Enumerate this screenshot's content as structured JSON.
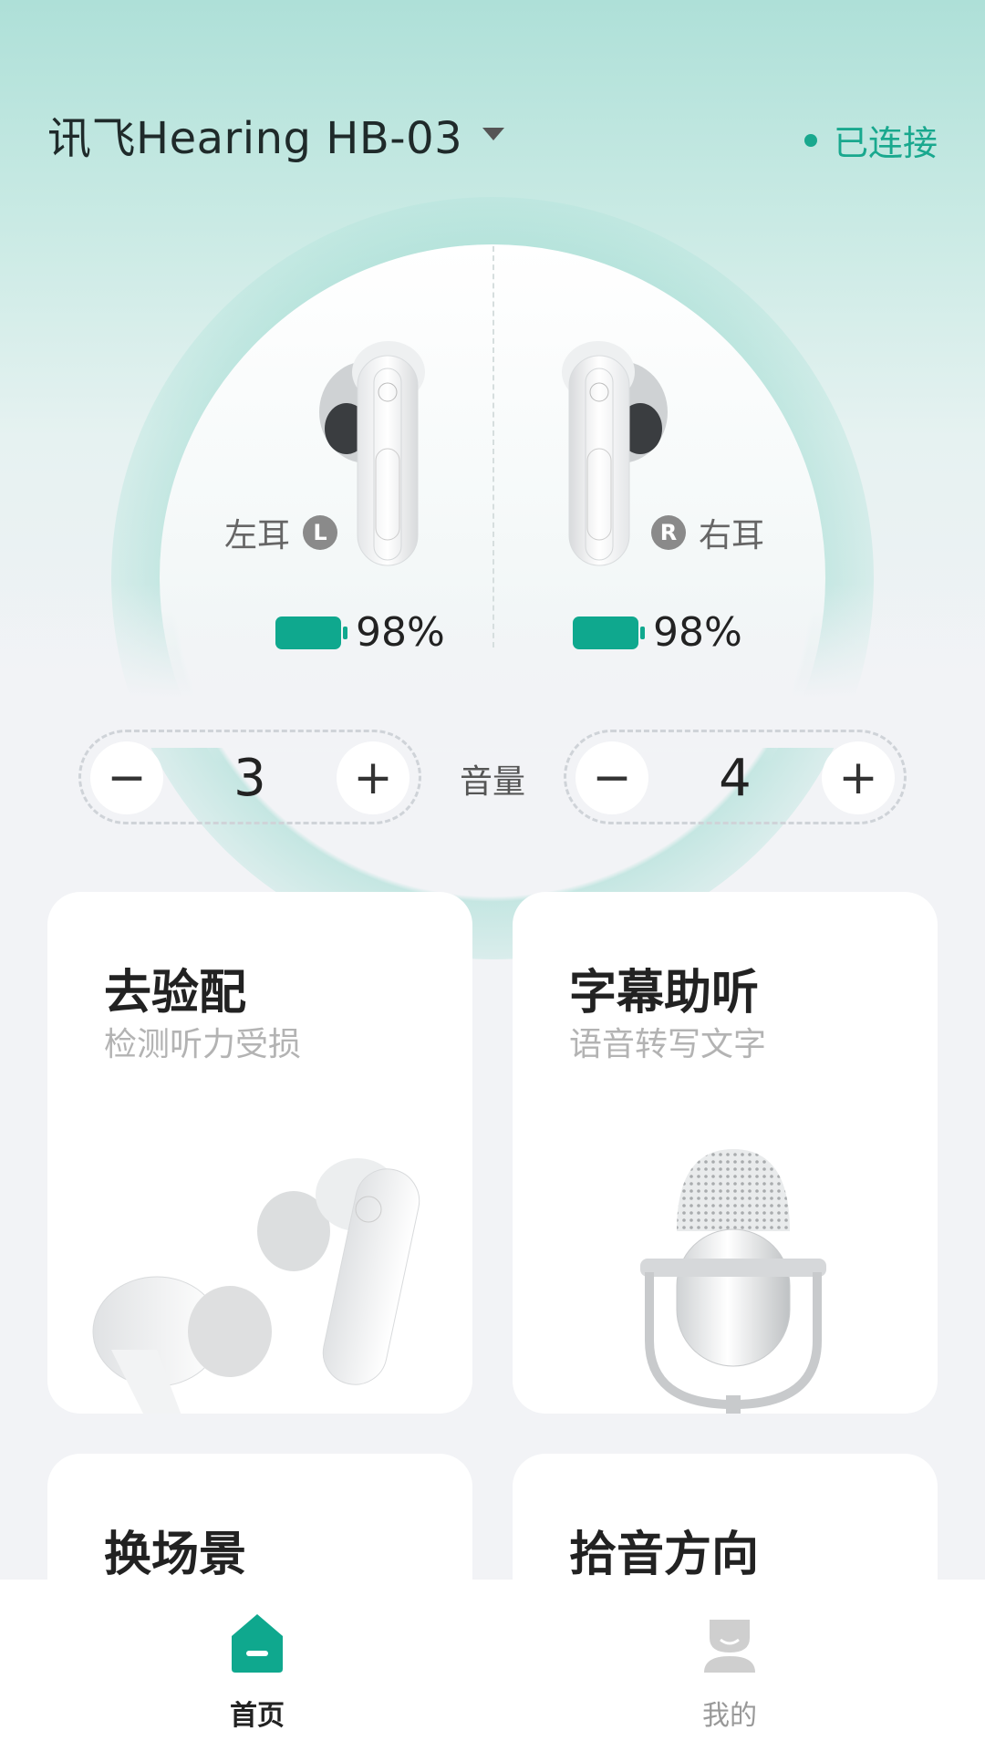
{
  "header": {
    "device_name": "讯飞Hearing HB-03",
    "status": "已连接"
  },
  "ears": {
    "left": {
      "label": "左耳",
      "badge": "L",
      "battery": "98%"
    },
    "right": {
      "label": "右耳",
      "badge": "R",
      "battery": "98%"
    }
  },
  "volume": {
    "label": "音量",
    "left_value": "3",
    "right_value": "4",
    "minus": "−",
    "plus": "+"
  },
  "cards": [
    {
      "title": "去验配",
      "subtitle": "检测听力受损"
    },
    {
      "title": "字幕助听",
      "subtitle": "语音转写文字"
    },
    {
      "title": "换场景"
    },
    {
      "title": "拾音方向"
    }
  ],
  "nav": {
    "home": "首页",
    "me": "我的"
  },
  "colors": {
    "accent": "#0fa88e",
    "status": "#19a88e",
    "bg_top": "#aee0d8"
  }
}
